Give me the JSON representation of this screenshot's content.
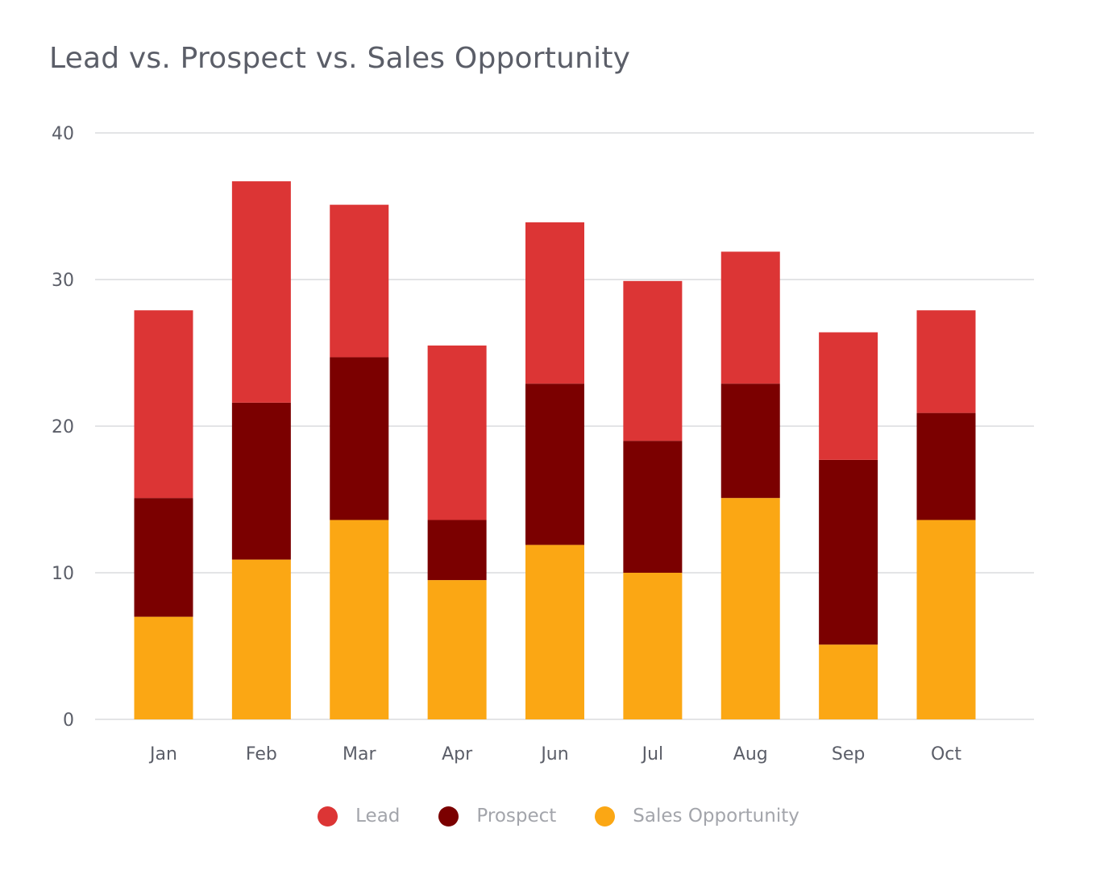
{
  "chart_data": {
    "type": "bar",
    "stacked": true,
    "title": "Lead vs. Prospect vs. Sales Opportunity",
    "xlabel": "",
    "ylabel": "",
    "ylim": [
      0,
      40
    ],
    "yticks": [
      0,
      10,
      20,
      30,
      40
    ],
    "grid": true,
    "legend_position": "bottom-center",
    "categories": [
      "Jan",
      "Feb",
      "Mar",
      "Apr",
      "Jun",
      "Jul",
      "Aug",
      "Sep",
      "Oct"
    ],
    "series": [
      {
        "name": "Sales Opportunity",
        "color": "#fba714",
        "values": [
          7,
          10.9,
          13.6,
          9.5,
          11.9,
          10,
          15.1,
          5.1,
          13.6
        ]
      },
      {
        "name": "Prospect",
        "color": "#7b0000",
        "values": [
          8.1,
          10.7,
          11.1,
          4.1,
          11,
          9,
          7.8,
          12.6,
          7.3
        ]
      },
      {
        "name": "Lead",
        "color": "#dc3535",
        "values": [
          12.8,
          15.1,
          10.4,
          11.9,
          11,
          10.9,
          9,
          8.7,
          7
        ]
      }
    ],
    "legend": [
      {
        "label": "Lead",
        "color": "#dc3535"
      },
      {
        "label": "Prospect",
        "color": "#7b0000"
      },
      {
        "label": "Sales Opportunity",
        "color": "#fba714"
      }
    ]
  }
}
